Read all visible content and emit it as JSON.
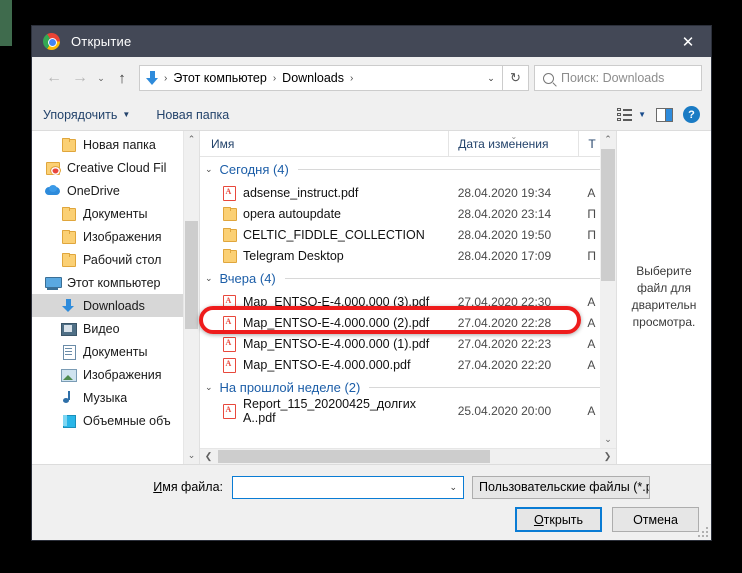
{
  "window": {
    "title": "Открытие",
    "app_icon": "chrome-icon",
    "close_label": "✕"
  },
  "nav": {
    "back_icon": "←",
    "forward_icon": "→",
    "recent_icon": "⌄",
    "up_icon": "↑",
    "breadcrumb": {
      "location_icon": "downloads-arrow-icon",
      "items": [
        "Этот компьютер",
        "Downloads"
      ],
      "separator": "›"
    },
    "address_dropdown_icon": "⌄",
    "refresh_icon": "↻",
    "search_placeholder": "Поиск: Downloads"
  },
  "toolbar": {
    "organize_label": "Упорядочить",
    "organize_caret": "▼",
    "new_folder_label": "Новая папка",
    "view_caret": "▼",
    "help_label": "?"
  },
  "sidebar": {
    "items": [
      {
        "label": "Новая папка",
        "icon": "folder-icon",
        "indent": 2,
        "state": "normal"
      },
      {
        "label": "Creative Cloud Fil",
        "icon": "creative-cloud-icon",
        "indent": 1,
        "state": "normal"
      },
      {
        "label": "OneDrive",
        "icon": "onedrive-icon",
        "indent": 1,
        "state": "normal"
      },
      {
        "label": "Документы",
        "icon": "folder-icon",
        "indent": 2,
        "state": "normal"
      },
      {
        "label": "Изображения",
        "icon": "folder-icon",
        "indent": 2,
        "state": "normal"
      },
      {
        "label": "Рабочий стол",
        "icon": "folder-icon",
        "indent": 2,
        "state": "normal"
      },
      {
        "label": "Этот компьютер",
        "icon": "this-pc-icon",
        "indent": 1,
        "state": "normal"
      },
      {
        "label": "Downloads",
        "icon": "downloads-icon",
        "indent": 2,
        "state": "selected"
      },
      {
        "label": "Видео",
        "icon": "video-icon",
        "indent": 2,
        "state": "normal"
      },
      {
        "label": "Документы",
        "icon": "documents-icon",
        "indent": 2,
        "state": "normal"
      },
      {
        "label": "Изображения",
        "icon": "pictures-icon",
        "indent": 2,
        "state": "normal"
      },
      {
        "label": "Музыка",
        "icon": "music-icon",
        "indent": 2,
        "state": "normal"
      },
      {
        "label": "Объемные объ",
        "icon": "3d-objects-icon",
        "indent": 2,
        "state": "normal"
      }
    ],
    "scroll_up_icon": "⌃",
    "scroll_down_icon": "⌄"
  },
  "filelist": {
    "columns": {
      "name": "Имя",
      "date": "Дата изменения",
      "type": "Т",
      "sort_indicator": "⌄"
    },
    "groups": [
      {
        "title": "Сегодня (4)",
        "caret": "⌄",
        "rows": [
          {
            "name": "adsense_instruct.pdf",
            "icon": "pdf-icon",
            "date": "28.04.2020 19:34",
            "type": "А"
          },
          {
            "name": "opera autoupdate",
            "icon": "folder-icon",
            "date": "28.04.2020 23:14",
            "type": "П"
          },
          {
            "name": "CELTIC_FIDDLE_COLLECTION",
            "icon": "folder-icon",
            "date": "28.04.2020 19:50",
            "type": "П"
          },
          {
            "name": "Telegram Desktop",
            "icon": "folder-icon",
            "date": "28.04.2020 17:09",
            "type": "П"
          }
        ]
      },
      {
        "title": "Вчера (4)",
        "caret": "⌄",
        "rows": [
          {
            "name": "Map_ENTSO-E-4.000.000 (3).pdf",
            "icon": "pdf-icon",
            "date": "27.04.2020 22:30",
            "type": "А",
            "highlighted": true
          },
          {
            "name": "Map_ENTSO-E-4.000.000 (2).pdf",
            "icon": "pdf-icon",
            "date": "27.04.2020 22:28",
            "type": "А"
          },
          {
            "name": "Map_ENTSO-E-4.000.000 (1).pdf",
            "icon": "pdf-icon",
            "date": "27.04.2020 22:23",
            "type": "А"
          },
          {
            "name": "Map_ENTSO-E-4.000.000.pdf",
            "icon": "pdf-icon",
            "date": "27.04.2020 22:20",
            "type": "А"
          }
        ]
      },
      {
        "title": "На прошлой неделе (2)",
        "caret": "⌄",
        "rows": [
          {
            "name": "Report_115_20200425_долгих А..pdf",
            "icon": "pdf-icon",
            "date": "25.04.2020 20:00",
            "type": "А"
          }
        ]
      }
    ],
    "scroll_up_icon": "⌃",
    "scroll_down_icon": "⌄",
    "scroll_left_icon": "❮",
    "scroll_right_icon": "❯"
  },
  "preview": {
    "lines": [
      "Выберите",
      "файл для",
      "дварительн",
      "просмотра."
    ]
  },
  "footer": {
    "filename_label_first": "И",
    "filename_label_rest": "мя файла:",
    "filename_value": "",
    "filename_caret": "⌄",
    "filter_value": "Пользовательские файлы (*.p",
    "filter_caret": "⌄",
    "open_label_first": "О",
    "open_label_rest": "ткрыть",
    "cancel_label": "Отмена"
  },
  "annotation": {
    "color": "#ee1c1c",
    "shape": "rounded-rectangle",
    "target": "Map_ENTSO-E-4.000.000 (3).pdf"
  }
}
